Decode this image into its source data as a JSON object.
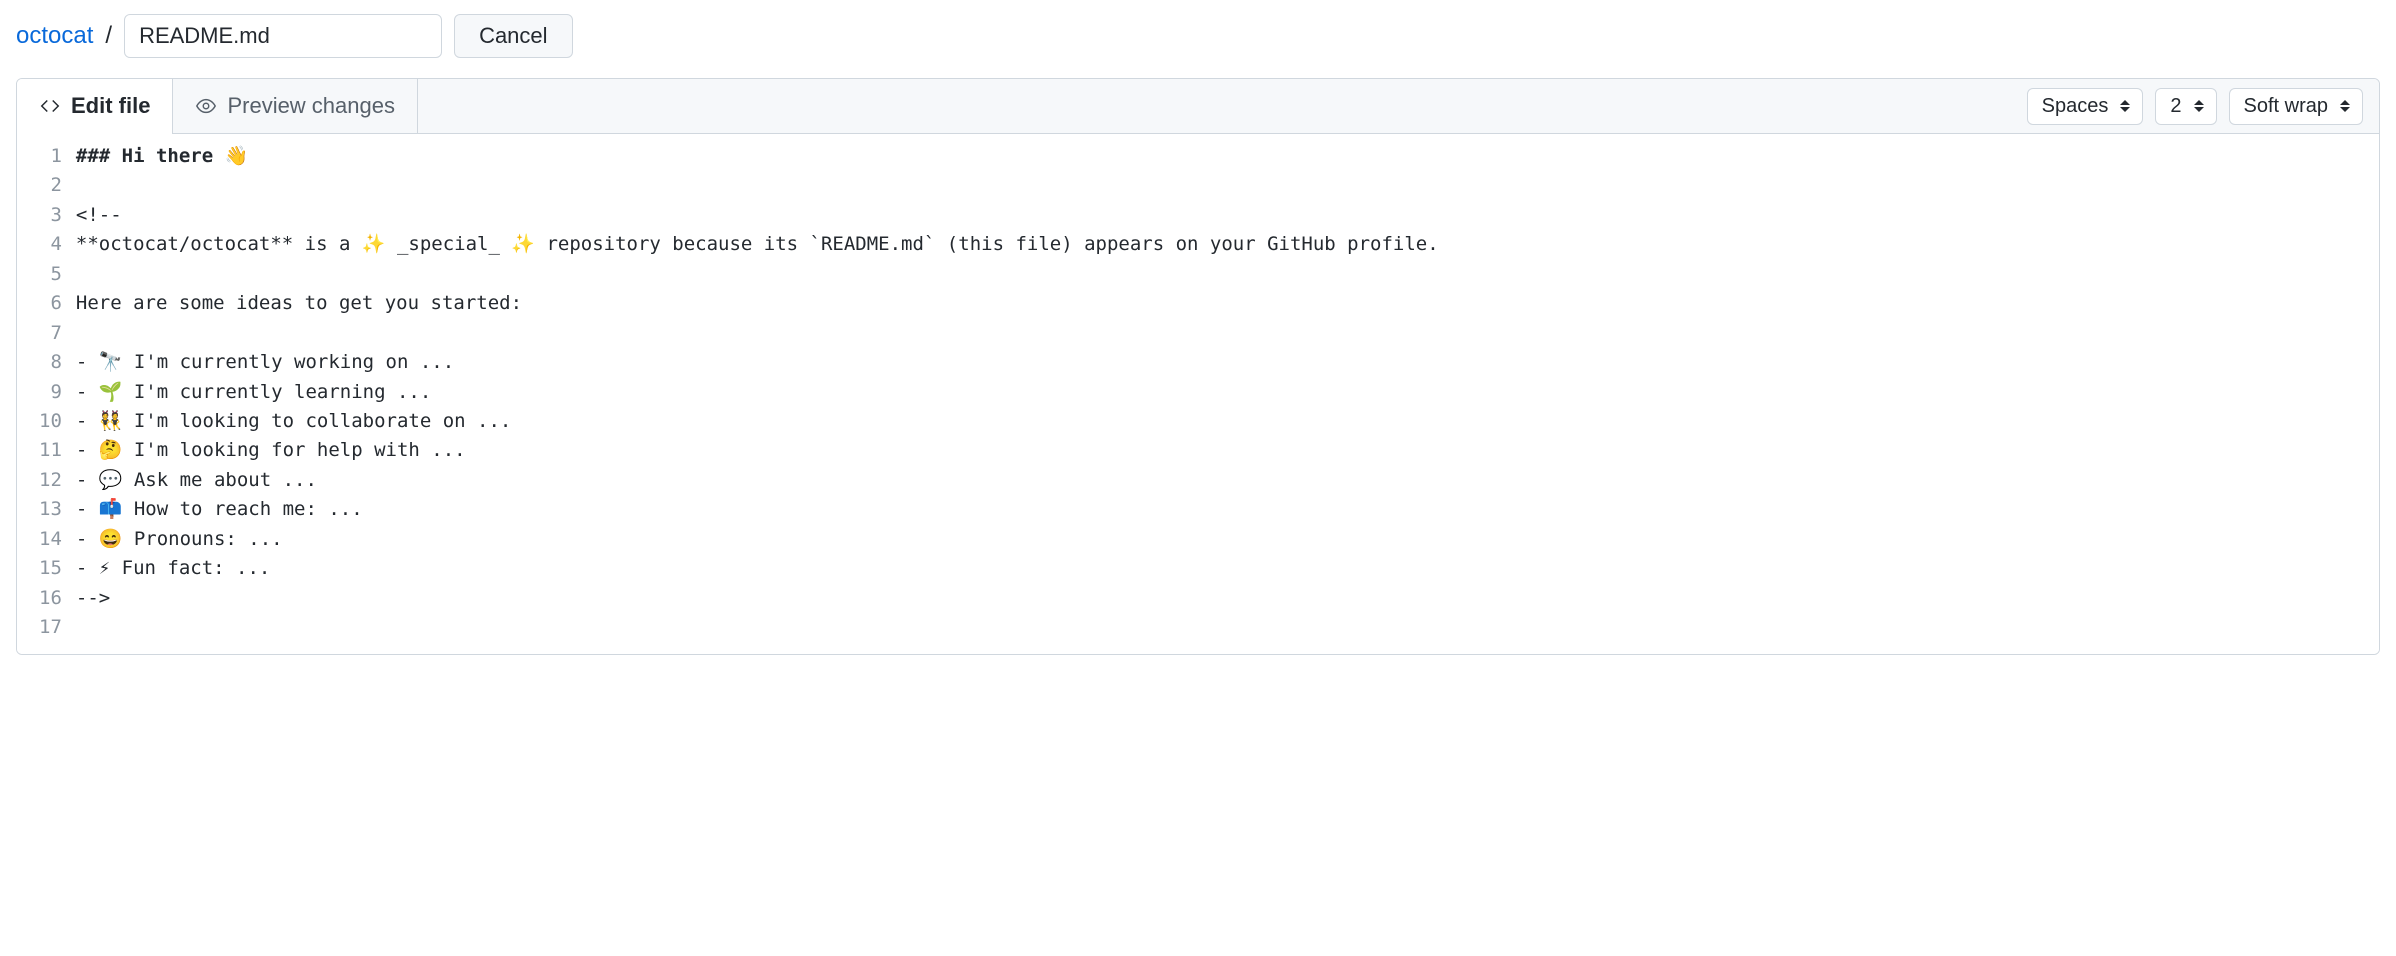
{
  "breadcrumb": {
    "repo": "octocat",
    "filename": "README.md",
    "cancel_label": "Cancel"
  },
  "tabs": {
    "edit": "Edit file",
    "preview": "Preview changes"
  },
  "toolbar": {
    "indent_mode": "Spaces",
    "indent_size": "2",
    "wrap_mode": "Soft wrap"
  },
  "editor": {
    "lines": [
      "### Hi there 👋",
      "",
      "<!--",
      "**octocat/octocat** is a ✨ _special_ ✨ repository because its `README.md` (this file) appears on your GitHub profile.",
      "",
      "Here are some ideas to get you started:",
      "",
      "- 🔭 I'm currently working on ...",
      "- 🌱 I'm currently learning ...",
      "- 👯 I'm looking to collaborate on ...",
      "- 🤔 I'm looking for help with ...",
      "- 💬 Ask me about ...",
      "- 📫 How to reach me: ...",
      "- 😄 Pronouns: ...",
      "- ⚡ Fun fact: ...",
      "-->",
      ""
    ]
  }
}
